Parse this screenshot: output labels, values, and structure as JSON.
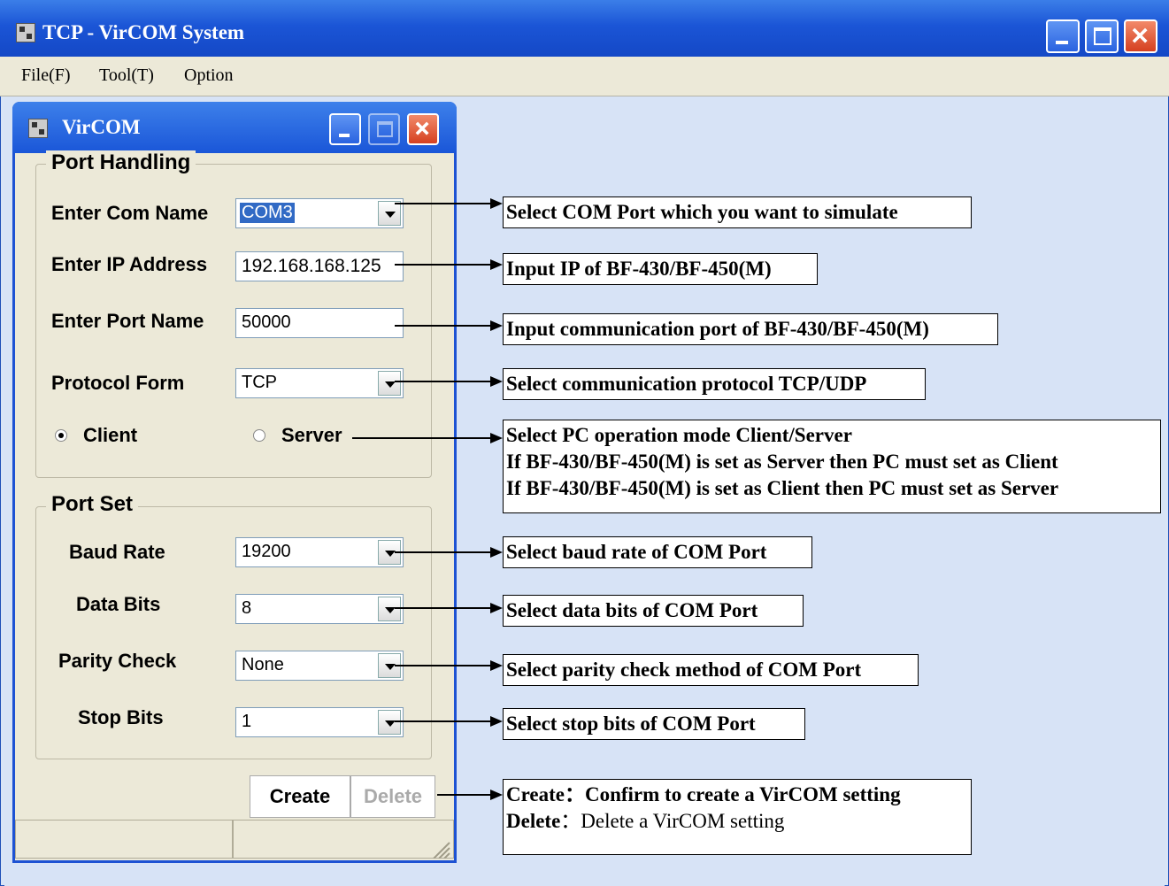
{
  "outer_window": {
    "title": "TCP - VirCOM System",
    "menu": [
      "File(F)",
      "Tool(T)",
      "Option"
    ]
  },
  "child_window": {
    "title": "VirCOM",
    "port_handling": {
      "legend": "Port Handling",
      "com_name_label": "Enter Com Name",
      "com_name_value": "COM3",
      "ip_label": "Enter IP Address",
      "ip_value": "192.168.168.125",
      "port_label": "Enter Port Name",
      "port_value": "50000",
      "protocol_label": "Protocol Form",
      "protocol_value": "TCP",
      "client_label": "Client",
      "server_label": "Server"
    },
    "port_set": {
      "legend": "Port Set",
      "baud_label": "Baud Rate",
      "baud_value": "19200",
      "data_bits_label": "Data Bits",
      "data_bits_value": "8",
      "parity_label": "Parity Check",
      "parity_value": "None",
      "stop_bits_label": "Stop Bits",
      "stop_bits_value": "1"
    },
    "buttons": {
      "create": "Create",
      "delete": "Delete"
    }
  },
  "callouts": {
    "com": "Select COM Port which you want to simulate",
    "ip": "Input IP of BF-430/BF-450(M)",
    "port": "Input communication port of BF-430/BF-450(M)",
    "protocol": "Select communication protocol TCP/UDP",
    "mode_1": "Select PC operation mode Client/Server",
    "mode_2": "If BF-430/BF-450(M) is set as Server then PC must set as Client",
    "mode_3": "If BF-430/BF-450(M) is set as Client then PC must set as Server",
    "baud": "Select baud rate of COM Port",
    "data_bits": "Select data bits of COM Port",
    "parity": "Select parity check method of COM Port",
    "stop_bits": "Select stop bits of COM Port",
    "create_label": "Create",
    "create_desc": "：Confirm to create a VirCOM setting",
    "delete_label": "Delete",
    "delete_desc": "：Delete a VirCOM setting"
  }
}
